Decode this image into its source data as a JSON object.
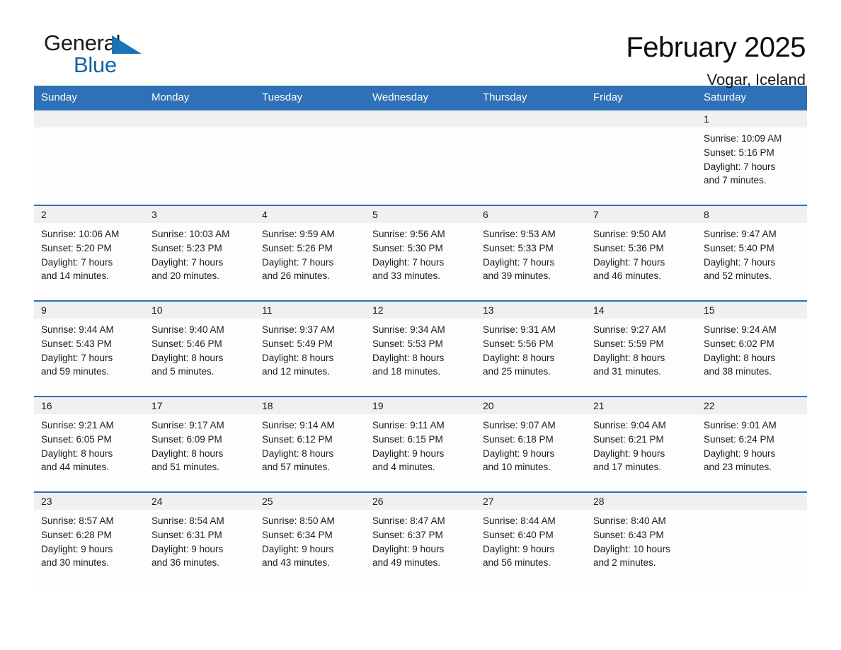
{
  "brand": {
    "name_top": "General",
    "name_bottom": "Blue",
    "triangle_icon": "brand-triangle-icon",
    "color_black": "#1a1a1a",
    "color_blue": "#1464a5"
  },
  "header": {
    "title": "February 2025",
    "subtitle": "Vogar, Iceland"
  },
  "theme": {
    "header_blue": "#2e71b8",
    "day_band_gray": "#f0f0f0",
    "cell_white": "#fdfdfd"
  },
  "weekdays": [
    "Sunday",
    "Monday",
    "Tuesday",
    "Wednesday",
    "Thursday",
    "Friday",
    "Saturday"
  ],
  "weeks": [
    [
      {
        "day": "",
        "lines": []
      },
      {
        "day": "",
        "lines": []
      },
      {
        "day": "",
        "lines": []
      },
      {
        "day": "",
        "lines": []
      },
      {
        "day": "",
        "lines": []
      },
      {
        "day": "",
        "lines": []
      },
      {
        "day": "1",
        "lines": [
          "Sunrise: 10:09 AM",
          "Sunset: 5:16 PM",
          "Daylight: 7 hours",
          "and 7 minutes."
        ]
      }
    ],
    [
      {
        "day": "2",
        "lines": [
          "Sunrise: 10:06 AM",
          "Sunset: 5:20 PM",
          "Daylight: 7 hours",
          "and 14 minutes."
        ]
      },
      {
        "day": "3",
        "lines": [
          "Sunrise: 10:03 AM",
          "Sunset: 5:23 PM",
          "Daylight: 7 hours",
          "and 20 minutes."
        ]
      },
      {
        "day": "4",
        "lines": [
          "Sunrise: 9:59 AM",
          "Sunset: 5:26 PM",
          "Daylight: 7 hours",
          "and 26 minutes."
        ]
      },
      {
        "day": "5",
        "lines": [
          "Sunrise: 9:56 AM",
          "Sunset: 5:30 PM",
          "Daylight: 7 hours",
          "and 33 minutes."
        ]
      },
      {
        "day": "6",
        "lines": [
          "Sunrise: 9:53 AM",
          "Sunset: 5:33 PM",
          "Daylight: 7 hours",
          "and 39 minutes."
        ]
      },
      {
        "day": "7",
        "lines": [
          "Sunrise: 9:50 AM",
          "Sunset: 5:36 PM",
          "Daylight: 7 hours",
          "and 46 minutes."
        ]
      },
      {
        "day": "8",
        "lines": [
          "Sunrise: 9:47 AM",
          "Sunset: 5:40 PM",
          "Daylight: 7 hours",
          "and 52 minutes."
        ]
      }
    ],
    [
      {
        "day": "9",
        "lines": [
          "Sunrise: 9:44 AM",
          "Sunset: 5:43 PM",
          "Daylight: 7 hours",
          "and 59 minutes."
        ]
      },
      {
        "day": "10",
        "lines": [
          "Sunrise: 9:40 AM",
          "Sunset: 5:46 PM",
          "Daylight: 8 hours",
          "and 5 minutes."
        ]
      },
      {
        "day": "11",
        "lines": [
          "Sunrise: 9:37 AM",
          "Sunset: 5:49 PM",
          "Daylight: 8 hours",
          "and 12 minutes."
        ]
      },
      {
        "day": "12",
        "lines": [
          "Sunrise: 9:34 AM",
          "Sunset: 5:53 PM",
          "Daylight: 8 hours",
          "and 18 minutes."
        ]
      },
      {
        "day": "13",
        "lines": [
          "Sunrise: 9:31 AM",
          "Sunset: 5:56 PM",
          "Daylight: 8 hours",
          "and 25 minutes."
        ]
      },
      {
        "day": "14",
        "lines": [
          "Sunrise: 9:27 AM",
          "Sunset: 5:59 PM",
          "Daylight: 8 hours",
          "and 31 minutes."
        ]
      },
      {
        "day": "15",
        "lines": [
          "Sunrise: 9:24 AM",
          "Sunset: 6:02 PM",
          "Daylight: 8 hours",
          "and 38 minutes."
        ]
      }
    ],
    [
      {
        "day": "16",
        "lines": [
          "Sunrise: 9:21 AM",
          "Sunset: 6:05 PM",
          "Daylight: 8 hours",
          "and 44 minutes."
        ]
      },
      {
        "day": "17",
        "lines": [
          "Sunrise: 9:17 AM",
          "Sunset: 6:09 PM",
          "Daylight: 8 hours",
          "and 51 minutes."
        ]
      },
      {
        "day": "18",
        "lines": [
          "Sunrise: 9:14 AM",
          "Sunset: 6:12 PM",
          "Daylight: 8 hours",
          "and 57 minutes."
        ]
      },
      {
        "day": "19",
        "lines": [
          "Sunrise: 9:11 AM",
          "Sunset: 6:15 PM",
          "Daylight: 9 hours",
          "and 4 minutes."
        ]
      },
      {
        "day": "20",
        "lines": [
          "Sunrise: 9:07 AM",
          "Sunset: 6:18 PM",
          "Daylight: 9 hours",
          "and 10 minutes."
        ]
      },
      {
        "day": "21",
        "lines": [
          "Sunrise: 9:04 AM",
          "Sunset: 6:21 PM",
          "Daylight: 9 hours",
          "and 17 minutes."
        ]
      },
      {
        "day": "22",
        "lines": [
          "Sunrise: 9:01 AM",
          "Sunset: 6:24 PM",
          "Daylight: 9 hours",
          "and 23 minutes."
        ]
      }
    ],
    [
      {
        "day": "23",
        "lines": [
          "Sunrise: 8:57 AM",
          "Sunset: 6:28 PM",
          "Daylight: 9 hours",
          "and 30 minutes."
        ]
      },
      {
        "day": "24",
        "lines": [
          "Sunrise: 8:54 AM",
          "Sunset: 6:31 PM",
          "Daylight: 9 hours",
          "and 36 minutes."
        ]
      },
      {
        "day": "25",
        "lines": [
          "Sunrise: 8:50 AM",
          "Sunset: 6:34 PM",
          "Daylight: 9 hours",
          "and 43 minutes."
        ]
      },
      {
        "day": "26",
        "lines": [
          "Sunrise: 8:47 AM",
          "Sunset: 6:37 PM",
          "Daylight: 9 hours",
          "and 49 minutes."
        ]
      },
      {
        "day": "27",
        "lines": [
          "Sunrise: 8:44 AM",
          "Sunset: 6:40 PM",
          "Daylight: 9 hours",
          "and 56 minutes."
        ]
      },
      {
        "day": "28",
        "lines": [
          "Sunrise: 8:40 AM",
          "Sunset: 6:43 PM",
          "Daylight: 10 hours",
          "and 2 minutes."
        ]
      },
      {
        "day": "",
        "lines": []
      }
    ]
  ]
}
